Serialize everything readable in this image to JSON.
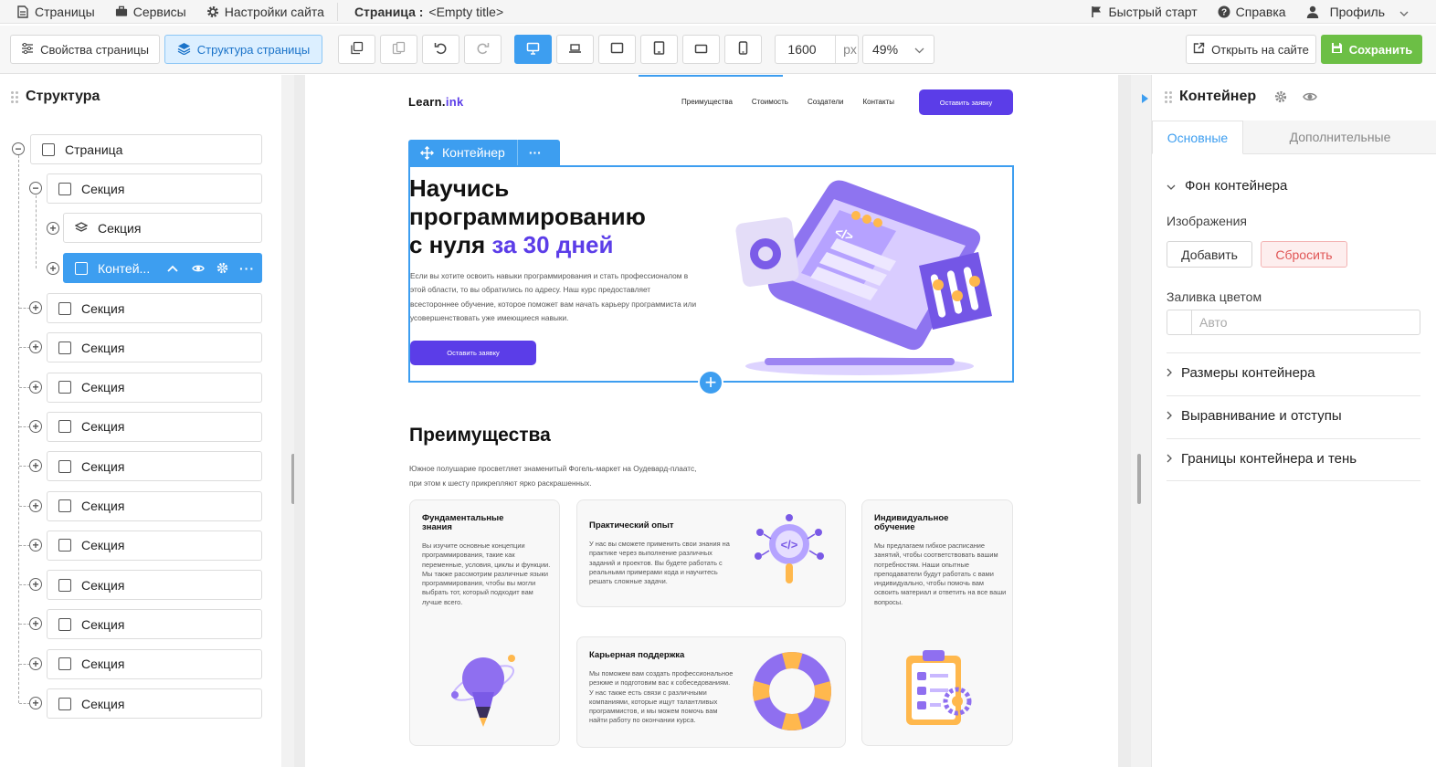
{
  "topbar": {
    "pages": "Страницы",
    "services": "Сервисы",
    "site_settings": "Настройки сайта",
    "page_label": "Страница :",
    "page_title": "<Empty title>",
    "quick_start": "Быстрый старт",
    "help": "Справка",
    "profile": "Профиль"
  },
  "toolbar": {
    "page_props": "Свойства страницы",
    "page_structure": "Структура страницы",
    "width_value": "1600",
    "width_unit": "px",
    "zoom": "49%",
    "open_site": "Открыть на сайте",
    "save": "Сохранить"
  },
  "structure": {
    "title": "Структура",
    "root": "Страница",
    "section1": "Секция",
    "section1_child": "Секция",
    "selected": "Контей...",
    "sections": [
      "Секция",
      "Секция",
      "Секция",
      "Секция",
      "Секция",
      "Секция",
      "Секция",
      "Секция",
      "Секция",
      "Секция",
      "Секция"
    ]
  },
  "site": {
    "logo_a": "Learn.",
    "logo_b": "ink",
    "nav": [
      "Преимущества",
      "Стоимость",
      "Создатели",
      "Контакты"
    ],
    "cta": "Оставить заявку",
    "container_label": "Контейнер",
    "container_more": "···",
    "hero_line1": "Научись",
    "hero_line2": "программированию",
    "hero_line3a": "с нуля ",
    "hero_line3b": "за 30 дней",
    "hero_text": "Если вы хотите освоить навыки программирования и стать профессионалом в этой области, то вы обратились по адресу. Наш курс предоставляет всестороннее обучение, которое поможет вам начать карьеру программиста или усовершенствовать уже имеющиеся навыки.",
    "hero_button": "Оставить заявку",
    "adv_title": "Преимущества",
    "adv_text": "Южное полушарие просветляет знаменитый Фогель-маркет на Оудевард-плаатс, при этом к шесту прикрепляют ярко раскрашенных.",
    "cards": [
      {
        "title": "Фундаментальные знания",
        "text": "Вы изучите основные концепции программирования, такие как переменные, условия, циклы и функции. Мы также рассмотрим различные языки программирования, чтобы вы могли выбрать тот, который подходит вам лучше всего."
      },
      {
        "title": "Практический опыт",
        "text": "У нас вы сможете применить свои знания на практике через выполнение различных заданий и проектов. Вы будете работать с реальными примерами кода и научитесь решать сложные задачи."
      },
      {
        "title": "Индивидуальное обучение",
        "text": "Мы предлагаем гибкое расписание занятий, чтобы соответствовать вашим потребностям. Наши опытные преподаватели будут работать с вами индивидуально, чтобы помочь вам освоить материал и ответить на все ваши вопросы."
      },
      {
        "title": "Карьерная поддержка",
        "text": "Мы поможем вам создать профессиональное резюме и подготовим вас к собеседованиям. У нас также есть связи с различными компаниями, которые ищут талантливых программистов, и мы можем помочь вам найти работу по окончании курса."
      }
    ]
  },
  "props": {
    "title": "Контейнер",
    "tab_main": "Основные",
    "tab_extra": "Дополнительные",
    "bg_section": "Фон контейнера",
    "images": "Изображения",
    "add": "Добавить",
    "reset": "Сбросить",
    "fill": "Заливка цветом",
    "fill_placeholder": "Авто",
    "size": "Размеры контейнера",
    "align": "Выравнивание и отступы",
    "borders": "Границы контейнера и тень"
  },
  "colors": {
    "accent_blue": "#3d9ef0",
    "brand_purple": "#5b3de8",
    "save_green": "#6cbf45"
  }
}
